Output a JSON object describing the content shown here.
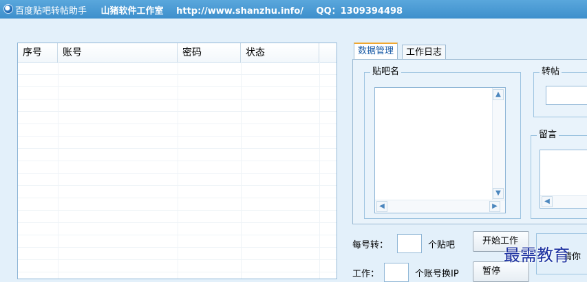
{
  "window": {
    "title": "百度贴吧转帖助手",
    "studio": "山猪软件工作室",
    "url": "http://www.shanzhu.info/",
    "qq": "QQ：1309394498"
  },
  "account_list": {
    "columns": [
      "序号",
      "账号",
      "密码",
      "状态"
    ],
    "rows": []
  },
  "tabs": [
    {
      "label": "数据管理",
      "active": true
    },
    {
      "label": "工作日志",
      "active": false
    }
  ],
  "panel": {
    "forum_group_title": "贴吧名",
    "forum_list_value": "",
    "repost_group_title": "转帖",
    "repost_value": "",
    "message_group_title": "留言",
    "message_value": ""
  },
  "controls": {
    "per_account_label": "每号转：",
    "per_account_value": "",
    "per_account_unit": "个贴吧",
    "start_button": "开始工作",
    "work_label": "工作：",
    "work_value": "",
    "work_unit": "个账号换IP",
    "second_button": "暂停",
    "clipped_text": "请你"
  },
  "overlay": {
    "watermark": "最需教育"
  },
  "colors": {
    "titlebar": "#3d8fcc",
    "background": "#e3f0fa",
    "tab_active_text": "#1f5fa8",
    "tab_accent": "#f0a830",
    "watermark": "#1a2fa0"
  }
}
